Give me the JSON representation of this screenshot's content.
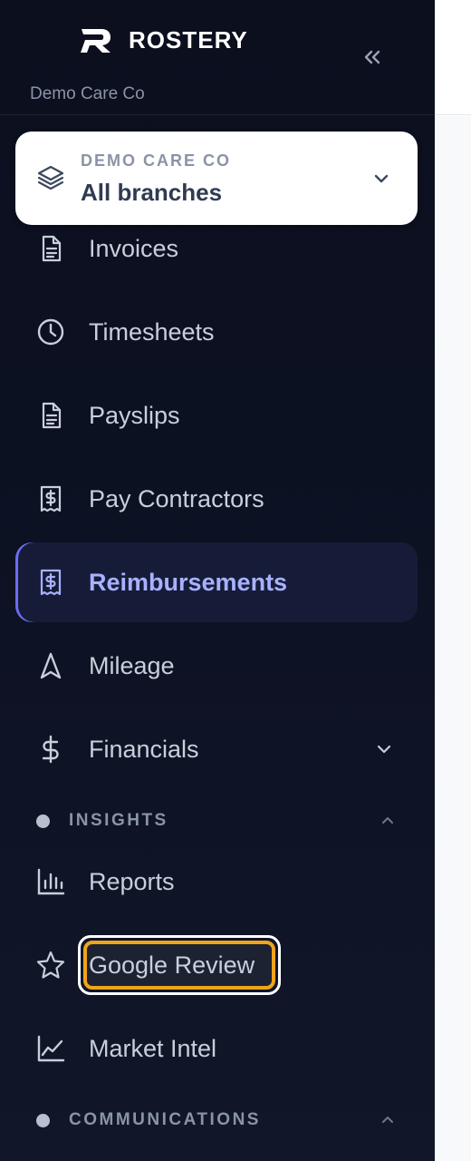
{
  "brand": {
    "name": "ROSTERY",
    "org_subtitle": "Demo Care Co",
    "collapse_icon": "chevrons-left-icon"
  },
  "branch_selector": {
    "kicker": "DEMO CARE CO",
    "value": "All branches",
    "icon": "layers-icon",
    "chevron": "chevron-down-icon"
  },
  "nav": {
    "items": [
      {
        "label": "Invoices",
        "icon": "document-icon"
      },
      {
        "label": "Timesheets",
        "icon": "clock-icon"
      },
      {
        "label": "Payslips",
        "icon": "document-icon"
      },
      {
        "label": "Pay Contractors",
        "icon": "receipt-dollar-icon"
      },
      {
        "label": "Reimbursements",
        "icon": "receipt-dollar-icon",
        "active": true
      },
      {
        "label": "Mileage",
        "icon": "navigation-arrow-icon"
      },
      {
        "label": "Financials",
        "icon": "dollar-icon",
        "expandable": true
      }
    ],
    "sections": [
      {
        "label": "INSIGHTS",
        "expanded": true,
        "items": [
          {
            "label": "Reports",
            "icon": "bar-chart-icon"
          },
          {
            "label": "Google Review",
            "icon": "star-icon",
            "focused": true
          },
          {
            "label": "Market Intel",
            "icon": "line-chart-icon"
          }
        ]
      },
      {
        "label": "COMMUNICATIONS",
        "expanded": true,
        "items": []
      }
    ]
  },
  "colors": {
    "sidebar_bg": "#0d1224",
    "active_accent": "#6d6cf3",
    "active_text": "#a9b1ff",
    "focus_ring": "#f0a41b"
  }
}
